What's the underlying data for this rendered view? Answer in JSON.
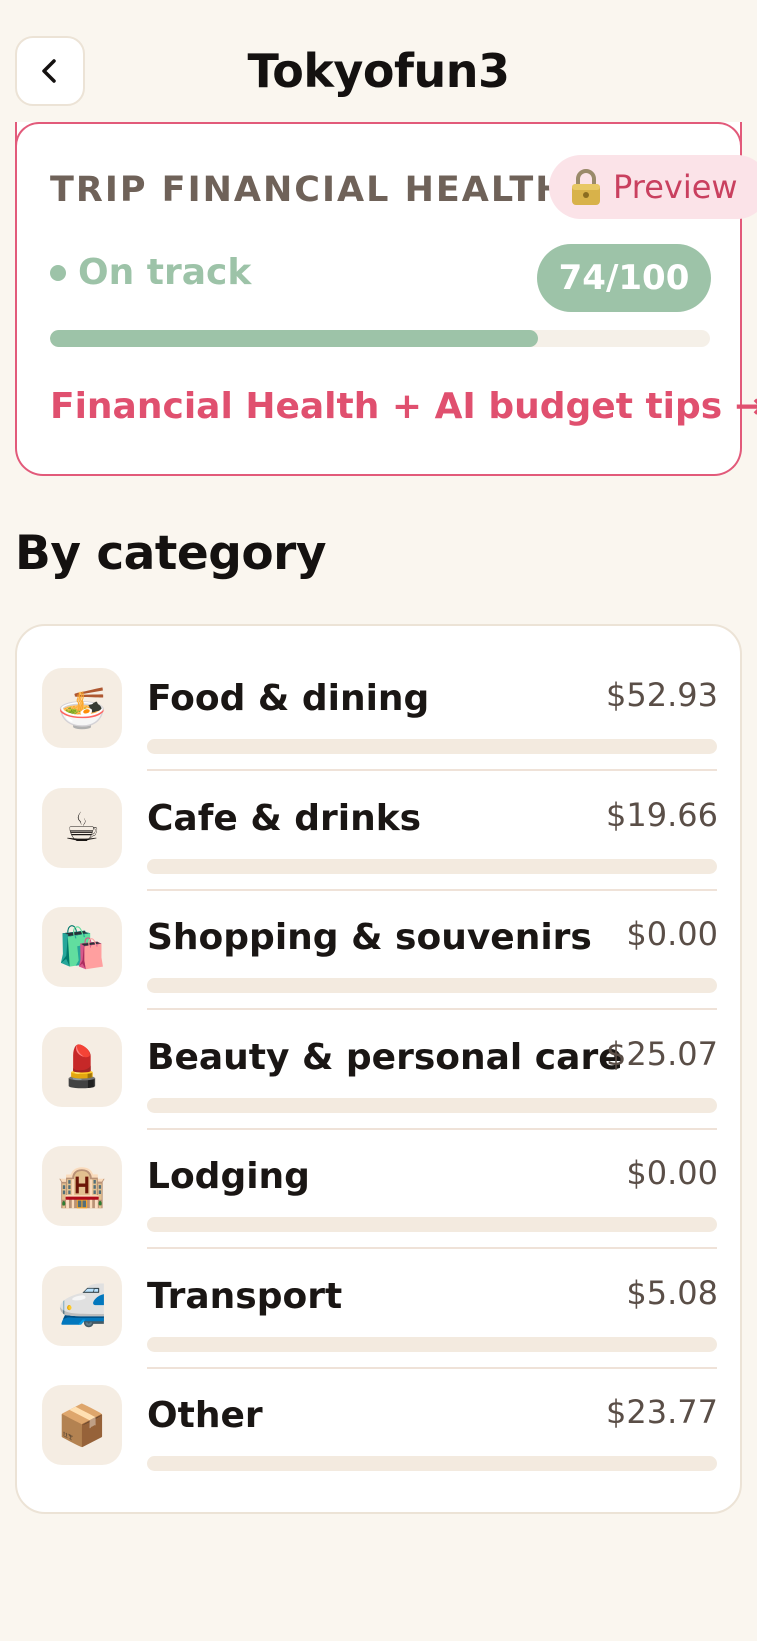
{
  "header": {
    "title": "Tokyofun3",
    "back_icon": "chevron-left-icon"
  },
  "health": {
    "heading": "TRIP FINANCIAL HEALTH",
    "preview_icon": "lock-icon",
    "preview_label": "Preview",
    "status": "On track",
    "score": "74/100",
    "score_value": 74,
    "score_max": 100,
    "link": "Financial Health + AI budget tips →",
    "colors": {
      "accent_pink": "#e0506f",
      "status_green": "#9dc3a8"
    }
  },
  "categories": {
    "title": "By category",
    "items": [
      {
        "name": "Food & dining",
        "amount": "$52.93",
        "icon": "noodle-bowl-icon",
        "emoji": "🍜"
      },
      {
        "name": "Cafe & drinks",
        "amount": "$19.66",
        "icon": "coffee-cup-icon",
        "emoji": "☕"
      },
      {
        "name": "Shopping & souvenirs",
        "amount": "$0.00",
        "icon": "shopping-bags-icon",
        "emoji": "🛍️"
      },
      {
        "name": "Beauty & personal care",
        "amount": "$25.07",
        "icon": "lipstick-icon",
        "emoji": "💄"
      },
      {
        "name": "Lodging",
        "amount": "$0.00",
        "icon": "hotel-icon",
        "emoji": "🏨"
      },
      {
        "name": "Transport",
        "amount": "$5.08",
        "icon": "bullet-train-icon",
        "emoji": "🚅"
      },
      {
        "name": "Other",
        "amount": "$23.77",
        "icon": "package-box-icon",
        "emoji": "📦"
      }
    ]
  }
}
